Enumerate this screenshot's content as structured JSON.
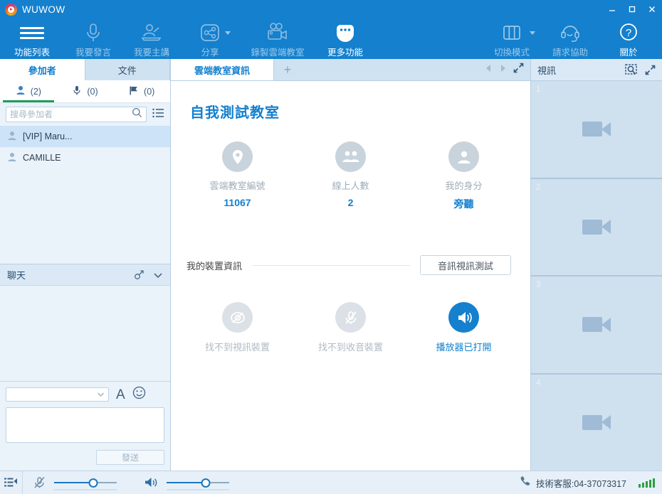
{
  "window": {
    "app_title": "WUWOW",
    "logo_icon": "wuwow-logo-icon",
    "minimize_label": "minimize",
    "maximize_label": "maximize",
    "close_label": "close"
  },
  "toolbar": {
    "items": [
      {
        "label": "功能列表",
        "icon": "hamburger-menu-icon",
        "active": true,
        "caret": false
      },
      {
        "label": "我要發言",
        "icon": "microphone-icon",
        "active": false,
        "caret": false
      },
      {
        "label": "我要主講",
        "icon": "presenter-icon",
        "active": false,
        "caret": false
      },
      {
        "label": "分享",
        "icon": "share-icon",
        "active": false,
        "caret": true
      },
      {
        "label": "錄製雲端教室",
        "icon": "record-camera-icon",
        "active": false,
        "caret": false
      },
      {
        "label": "更多功能",
        "icon": "more-dots-icon",
        "active": true,
        "caret": false
      }
    ],
    "right_items": [
      {
        "label": "切換模式",
        "icon": "layout-switch-icon",
        "caret": true
      },
      {
        "label": "請求協助",
        "icon": "headset-icon",
        "caret": false
      },
      {
        "label": "關於",
        "icon": "question-circle-icon",
        "caret": false
      }
    ]
  },
  "left_panel": {
    "tabs": [
      {
        "label": "參加者",
        "active": true
      },
      {
        "label": "文件",
        "active": false
      }
    ],
    "counts": [
      {
        "icon": "person-icon",
        "value": "(2)",
        "selected": true
      },
      {
        "icon": "microphone-icon",
        "value": "(0)",
        "selected": false
      },
      {
        "icon": "flag-icon",
        "value": "(0)",
        "selected": false
      }
    ],
    "search": {
      "placeholder": "搜尋參加者",
      "value": "",
      "search_icon": "search-icon",
      "list_icon": "list-view-icon"
    },
    "participants": [
      {
        "name": "[VIP] Maru...",
        "icon": "person-icon",
        "selected": true
      },
      {
        "name": "CAMILLE",
        "icon": "person-icon",
        "selected": false
      }
    ],
    "chat": {
      "title": "聊天",
      "popout_icon": "popout-arrow-icon",
      "collapse_icon": "chevron-down-icon",
      "select_value": "",
      "font_button": "A",
      "emoji_icon": "smiley-icon",
      "message_value": "",
      "send_label": "發送"
    }
  },
  "center_panel": {
    "tabs": [
      {
        "label": "雲端教室資訊",
        "active": true
      }
    ],
    "add_tab_icon": "plus-icon",
    "prev_icon": "triangle-left-icon",
    "next_icon": "triangle-right-icon",
    "expand_icon": "expand-diagonal-icon",
    "room_title": "自我測試教室",
    "stats": [
      {
        "icon": "location-pin-icon",
        "label": "雲端教室編號",
        "value": "11067"
      },
      {
        "icon": "group-people-icon",
        "label": "線上人數",
        "value": "2"
      },
      {
        "icon": "person-icon",
        "label": "我的身分",
        "value": "旁聽"
      }
    ],
    "device_section": {
      "label": "我的裝置資訊",
      "test_button": "音訊視訊測試"
    },
    "devices": [
      {
        "icon": "camera-off-icon",
        "label": "找不到視訊裝置",
        "state": "off"
      },
      {
        "icon": "microphone-off-icon",
        "label": "找不到收音裝置",
        "state": "off"
      },
      {
        "icon": "speaker-on-icon",
        "label": "播放器已打開",
        "state": "on"
      }
    ]
  },
  "right_panel": {
    "title": "視訊",
    "snapshot_icon": "video-search-icon",
    "expand_icon": "expand-diagonal-icon",
    "slots": [
      {
        "number": "1",
        "icon": "camera-placeholder-icon"
      },
      {
        "number": "2",
        "icon": "camera-placeholder-icon"
      },
      {
        "number": "3",
        "icon": "camera-placeholder-icon"
      },
      {
        "number": "4",
        "icon": "camera-placeholder-icon"
      }
    ]
  },
  "status_bar": {
    "list_icon": "list-panel-icon",
    "mic_icon": "microphone-muted-icon",
    "mic_volume": 62,
    "speaker_icon": "speaker-icon",
    "speaker_volume": 62,
    "phone_icon": "phone-icon",
    "support_text": "技術客服:04-37073317",
    "signal_icon": "signal-bars-icon"
  },
  "colors": {
    "brand_blue": "#1480ce",
    "panel_blue": "#cfe0ef",
    "tab_blue": "#cfe2f2",
    "signal_green": "#2f9e44",
    "selected_row": "#cde3f7"
  }
}
